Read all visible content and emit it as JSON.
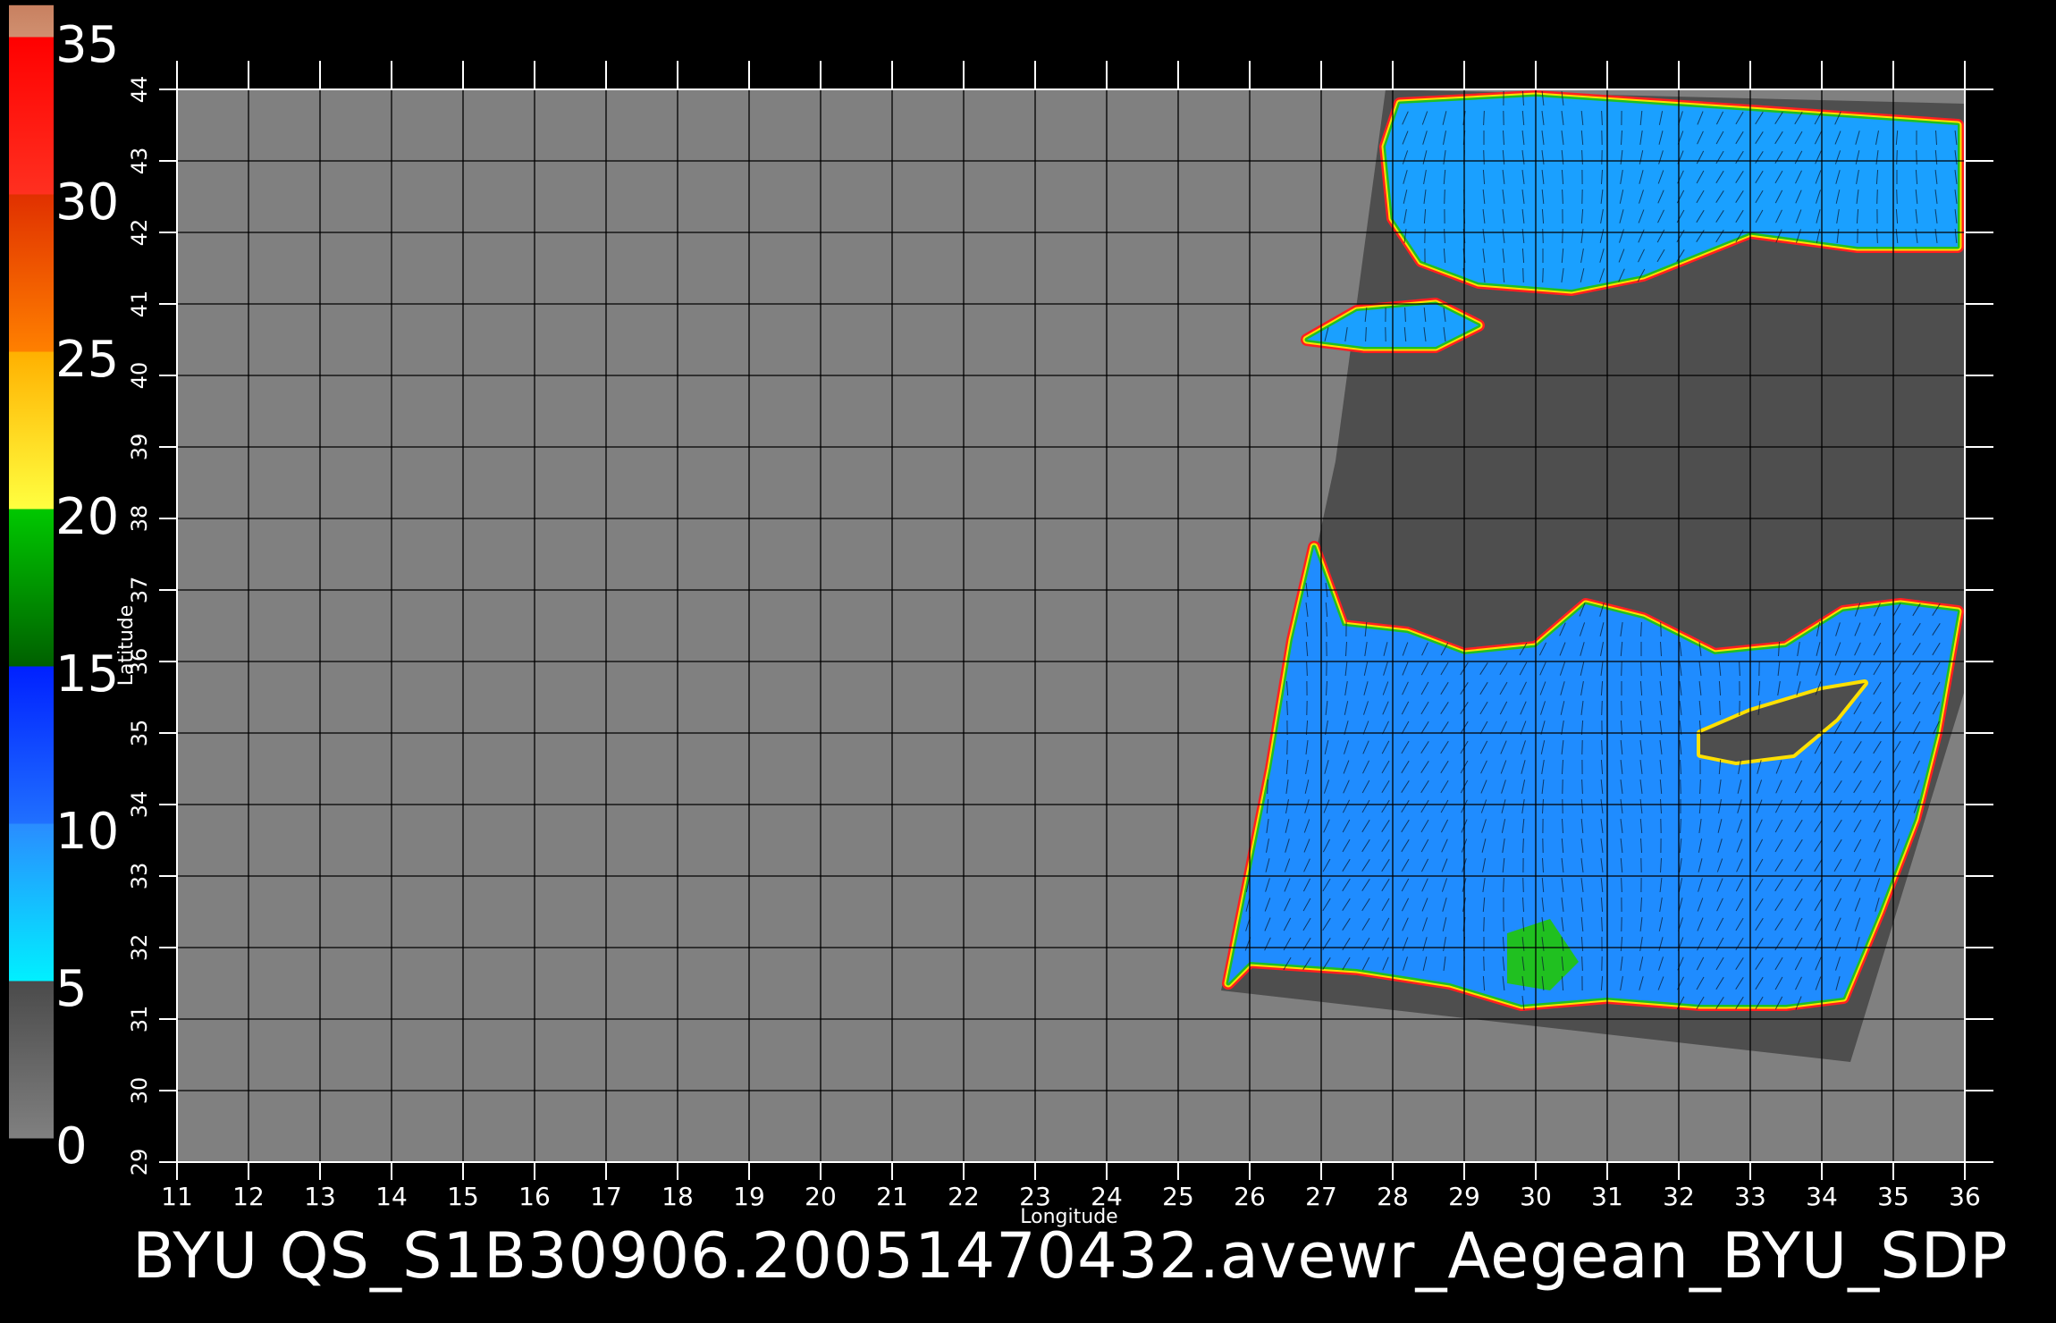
{
  "colorbar": {
    "tick_labels": [
      "0",
      "5",
      "10",
      "15",
      "20",
      "25",
      "30",
      "35"
    ],
    "stops": [
      {
        "from": 0,
        "to": 5,
        "top": "#4a4a4a",
        "bottom": "#808080"
      },
      {
        "from": 5,
        "to": 10,
        "top": "#2a8cff",
        "bottom": "#00f0ff"
      },
      {
        "from": 10,
        "to": 15,
        "top": "#0020ff",
        "bottom": "#2070ff"
      },
      {
        "from": 15,
        "to": 20,
        "top": "#00c800",
        "bottom": "#006000"
      },
      {
        "from": 20,
        "to": 25,
        "top": "#ffb000",
        "bottom": "#ffff40"
      },
      {
        "from": 25,
        "to": 30,
        "top": "#e03000",
        "bottom": "#ff8000"
      },
      {
        "from": 30,
        "to": 35,
        "top": "#ff0000",
        "bottom": "#ff3020"
      },
      {
        "from": 35,
        "to": 36,
        "top": "#c88060",
        "bottom": "#d09070"
      }
    ]
  },
  "map": {
    "xlabel": "Longitude",
    "ylabel": "Latitude",
    "xlim": [
      11,
      36
    ],
    "ylim": [
      29,
      44
    ],
    "x_ticks": [
      "11",
      "12",
      "13",
      "14",
      "15",
      "16",
      "17",
      "18",
      "19",
      "20",
      "21",
      "22",
      "23",
      "24",
      "25",
      "26",
      "27",
      "28",
      "29",
      "30",
      "31",
      "32",
      "33",
      "34",
      "35",
      "36"
    ],
    "y_ticks": [
      "29",
      "30",
      "31",
      "32",
      "33",
      "34",
      "35",
      "36",
      "37",
      "38",
      "39",
      "40",
      "41",
      "42",
      "43",
      "44"
    ],
    "background_color": "#808080",
    "swath_color": "#4e4e4e",
    "swath_corners_lonlat": [
      [
        27.9,
        44.0
      ],
      [
        36.0,
        43.8
      ],
      [
        36.0,
        35.6
      ],
      [
        34.4,
        30.4
      ],
      [
        25.6,
        31.4
      ],
      [
        27.2,
        38.8
      ]
    ],
    "wind_regions_lonlat": [
      {
        "name": "black-sea",
        "color": "#1aa0ff",
        "points": [
          [
            28.1,
            43.8
          ],
          [
            30.0,
            43.9
          ],
          [
            33.0,
            43.7
          ],
          [
            35.9,
            43.5
          ],
          [
            35.9,
            41.8
          ],
          [
            34.5,
            41.8
          ],
          [
            33.0,
            42.0
          ],
          [
            31.5,
            41.4
          ],
          [
            30.5,
            41.2
          ],
          [
            29.2,
            41.3
          ],
          [
            28.4,
            41.6
          ],
          [
            28.0,
            42.2
          ],
          [
            27.9,
            43.2
          ]
        ]
      },
      {
        "name": "marmara",
        "color": "#1aa0ff",
        "points": [
          [
            26.8,
            40.5
          ],
          [
            27.5,
            40.9
          ],
          [
            28.6,
            41.0
          ],
          [
            29.2,
            40.7
          ],
          [
            28.6,
            40.4
          ],
          [
            27.6,
            40.4
          ]
        ]
      },
      {
        "name": "mediterranean",
        "color": "#1f8cff",
        "points": [
          [
            26.9,
            37.6
          ],
          [
            27.3,
            36.5
          ],
          [
            28.2,
            36.4
          ],
          [
            29.0,
            36.1
          ],
          [
            30.0,
            36.2
          ],
          [
            30.7,
            36.8
          ],
          [
            31.5,
            36.6
          ],
          [
            32.5,
            36.1
          ],
          [
            33.5,
            36.2
          ],
          [
            34.3,
            36.7
          ],
          [
            35.1,
            36.8
          ],
          [
            35.9,
            36.7
          ],
          [
            35.6,
            35.0
          ],
          [
            35.3,
            33.8
          ],
          [
            34.8,
            32.5
          ],
          [
            34.3,
            31.3
          ],
          [
            33.5,
            31.2
          ],
          [
            32.3,
            31.2
          ],
          [
            31.0,
            31.3
          ],
          [
            29.8,
            31.2
          ],
          [
            28.8,
            31.5
          ],
          [
            27.5,
            31.7
          ],
          [
            26.0,
            31.8
          ],
          [
            25.7,
            31.5
          ],
          [
            26.3,
            34.5
          ],
          [
            26.6,
            36.3
          ]
        ]
      },
      {
        "name": "egypt-coast-green",
        "color": "#20c020",
        "points": [
          [
            29.6,
            32.2
          ],
          [
            30.2,
            32.4
          ],
          [
            30.6,
            31.8
          ],
          [
            30.2,
            31.4
          ],
          [
            29.6,
            31.5
          ]
        ]
      }
    ],
    "land_holes_lonlat": [
      {
        "name": "cyprus",
        "points": [
          [
            32.3,
            35.0
          ],
          [
            33.0,
            35.3
          ],
          [
            34.0,
            35.6
          ],
          [
            34.6,
            35.7
          ],
          [
            34.2,
            35.2
          ],
          [
            33.6,
            34.7
          ],
          [
            32.8,
            34.6
          ],
          [
            32.3,
            34.7
          ]
        ]
      }
    ]
  },
  "caption": "BYU  QS_S1B30906.20051470432.avewr_Aegean_BYU_SDP"
}
